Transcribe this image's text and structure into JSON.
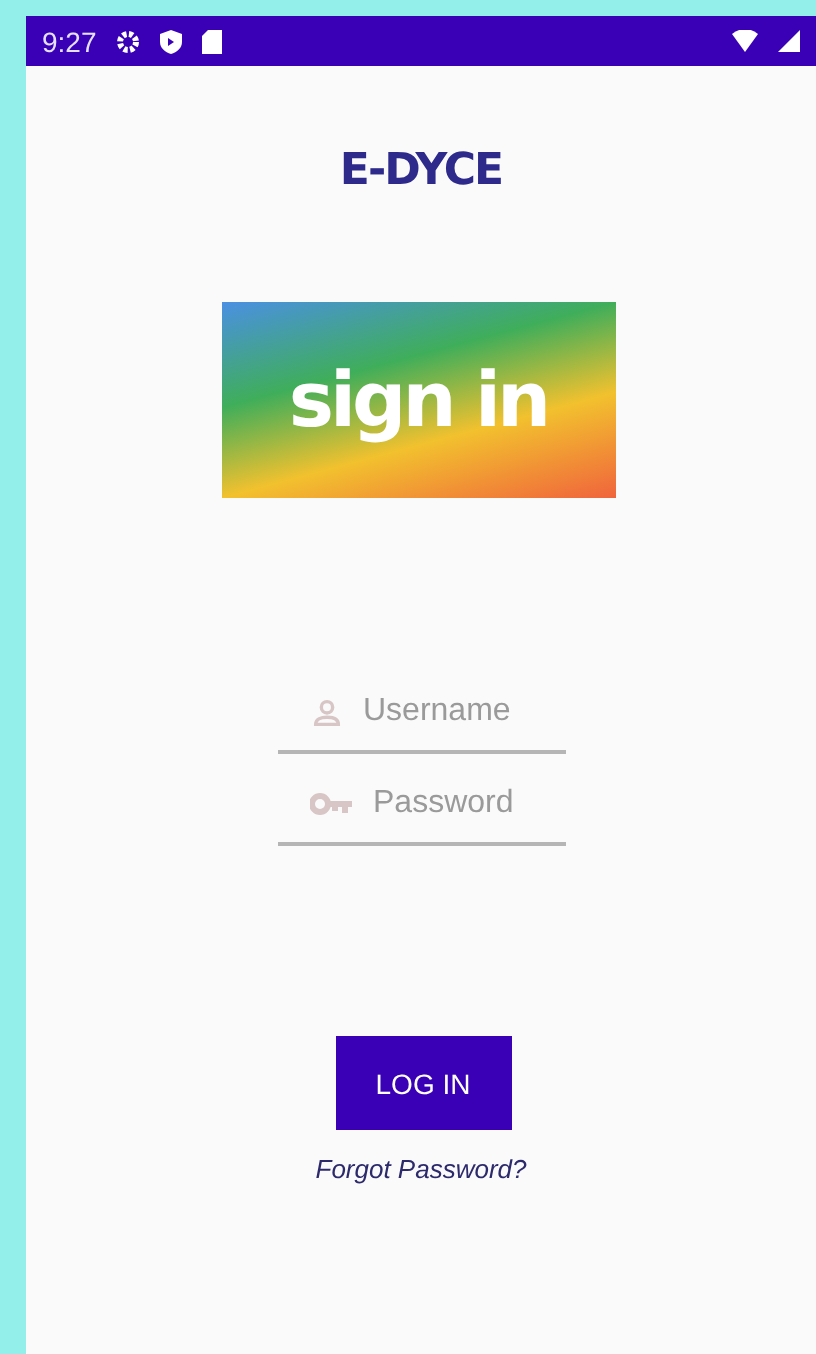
{
  "status_bar": {
    "time": "9:27"
  },
  "logo": {
    "text": "E-DYCE"
  },
  "banner": {
    "text": "sign in"
  },
  "fields": [
    {
      "kind": "user",
      "placeholder": "Username"
    },
    {
      "kind": "password",
      "placeholder": "Password"
    }
  ],
  "login_button": {
    "label": "LOG IN"
  },
  "forgot_link": {
    "label": "Forgot Password?"
  }
}
